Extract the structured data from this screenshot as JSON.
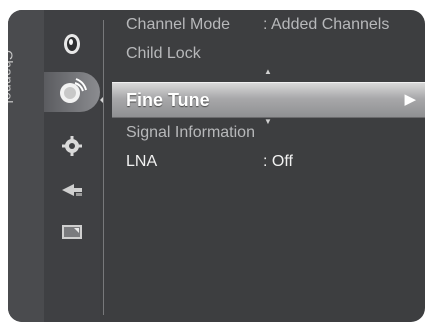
{
  "sidebar": {
    "section_label": "Channel",
    "icons": [
      "picture-icon",
      "channel-icon",
      "setup-icon",
      "input-icon",
      "application-icon"
    ]
  },
  "menu": {
    "channel_mode": {
      "label": "Channel Mode",
      "value": ": Added Channels"
    },
    "child_lock": {
      "label": "Child Lock"
    },
    "fine_tune": {
      "label": "Fine Tune",
      "arrow": "▶"
    },
    "signal_information": {
      "label": "Signal Information"
    },
    "lna": {
      "label": "LNA",
      "value": ": Off"
    }
  },
  "colors": {
    "panel_bg": "#3d3e40",
    "highlight": "#a8a8aa",
    "text": "#cfcfcf"
  }
}
